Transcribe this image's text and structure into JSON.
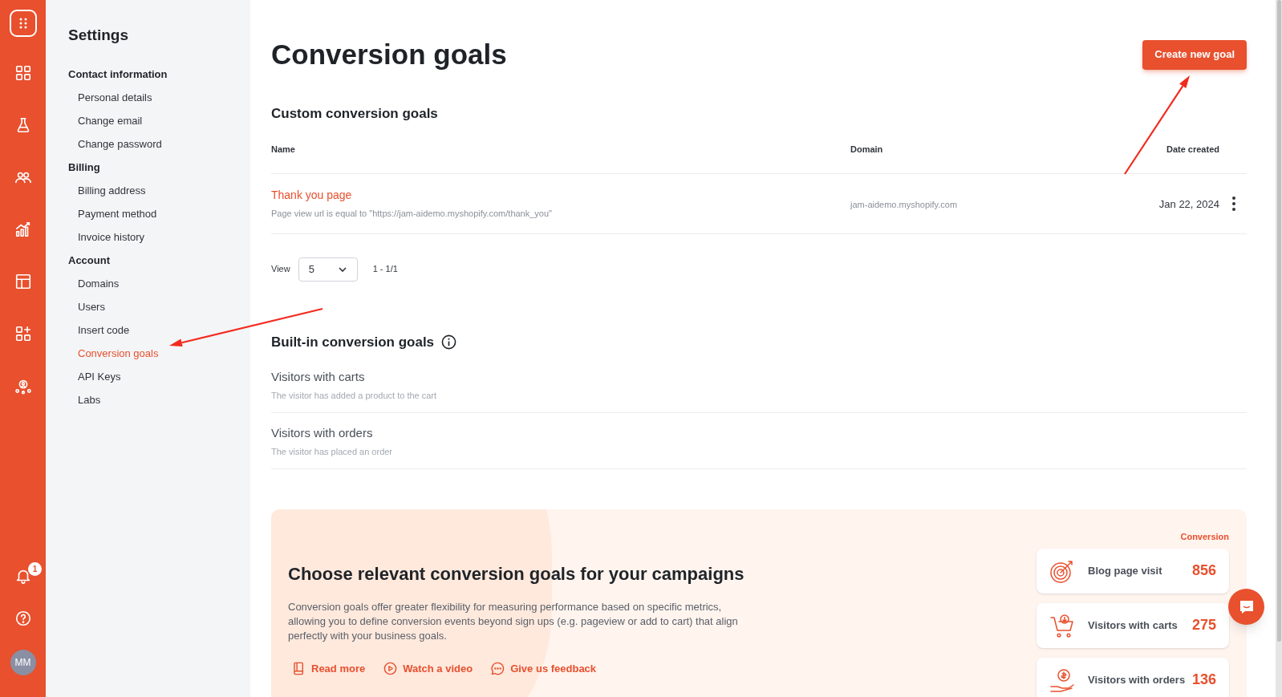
{
  "rail": {
    "items": [
      {
        "kind": "logo"
      },
      {
        "kind": "grid"
      },
      {
        "kind": "flask"
      },
      {
        "kind": "users"
      },
      {
        "kind": "chart"
      },
      {
        "kind": "layout"
      },
      {
        "kind": "apps"
      },
      {
        "kind": "network"
      }
    ],
    "bottom": [
      {
        "kind": "bell",
        "badge": "1"
      },
      {
        "kind": "help"
      },
      {
        "kind": "avatar",
        "initials": "MM"
      }
    ]
  },
  "settings": {
    "title": "Settings",
    "sections": [
      {
        "label": "Contact information",
        "items": [
          {
            "label": "Personal details",
            "selected": false
          },
          {
            "label": "Change email",
            "selected": false
          },
          {
            "label": "Change password",
            "selected": false
          }
        ]
      },
      {
        "label": "Billing",
        "items": [
          {
            "label": "Billing address",
            "selected": false
          },
          {
            "label": "Payment method",
            "selected": false
          },
          {
            "label": "Invoice history",
            "selected": false
          }
        ]
      },
      {
        "label": "Account",
        "items": [
          {
            "label": "Domains",
            "selected": false
          },
          {
            "label": "Users",
            "selected": false
          },
          {
            "label": "Insert code",
            "selected": false
          },
          {
            "label": "Conversion goals",
            "selected": true
          },
          {
            "label": "API Keys",
            "selected": false
          },
          {
            "label": "Labs",
            "selected": false
          }
        ]
      }
    ]
  },
  "page": {
    "title": "Conversion goals",
    "create_button": "Create new goal"
  },
  "custom_goals": {
    "title": "Custom conversion goals",
    "columns": [
      "Name",
      "Domain",
      "Date created"
    ],
    "rows": [
      {
        "name": "Thank you page",
        "rule": "Page view url is equal to \"https://jam-aidemo.myshopify.com/thank_you\"",
        "domain": "jam-aidemo.myshopify.com",
        "date": "Jan 22, 2024"
      }
    ],
    "pager": {
      "label": "View",
      "value": "5",
      "range": "1 - 1/1"
    }
  },
  "builtin_goals": {
    "title": "Built-in conversion goals",
    "items": [
      {
        "name": "Visitors with carts",
        "description": "The visitor has added a product to the cart"
      },
      {
        "name": "Visitors with orders",
        "description": "The visitor has placed an order"
      }
    ]
  },
  "banner": {
    "title": "Choose relevant conversion goals for your campaigns",
    "body": "Conversion goals offer greater flexibility for measuring performance based on specific metrics, allowing you to define conversion events beyond sign ups (e.g. pageview or add to cart) that align perfectly with your business goals.",
    "links": [
      {
        "kind": "book",
        "label": "Read more"
      },
      {
        "kind": "play",
        "label": "Watch a video"
      },
      {
        "kind": "chat",
        "label": "Give us feedback"
      }
    ],
    "column_label": "Conversion",
    "cards": [
      {
        "kind": "target",
        "label": "Blog page visit",
        "value": "856"
      },
      {
        "kind": "cart",
        "label": "Visitors with carts",
        "value": "275"
      },
      {
        "kind": "money",
        "label": "Visitors with orders",
        "value": "136"
      }
    ]
  },
  "annotations": [
    {
      "kind": "arrow"
    },
    {
      "kind": "arrow"
    }
  ]
}
